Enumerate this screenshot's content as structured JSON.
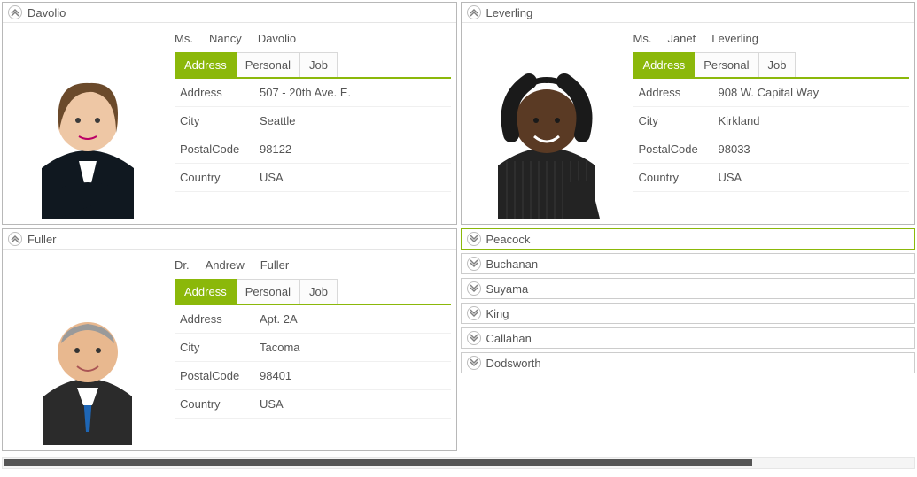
{
  "tabs": {
    "address": "Address",
    "personal": "Personal",
    "job": "Job"
  },
  "field_labels": {
    "address": "Address",
    "city": "City",
    "postal": "PostalCode",
    "country": "Country"
  },
  "left": [
    {
      "header": "Davolio",
      "expanded": true,
      "title": "Ms.",
      "first": "Nancy",
      "last": "Davolio",
      "address": "507 - 20th Ave. E.",
      "city": "Seattle",
      "postal": "98122",
      "country": "USA",
      "photo": "woman-darkblonde-suit"
    },
    {
      "header": "Fuller",
      "expanded": true,
      "title": "Dr.",
      "first": "Andrew",
      "last": "Fuller",
      "address": "Apt. 2A",
      "city": "Tacoma",
      "postal": "98401",
      "country": "USA",
      "photo": "man-gray-suit-tie"
    }
  ],
  "right": [
    {
      "header": "Leverling",
      "expanded": true,
      "title": "Ms.",
      "first": "Janet",
      "last": "Leverling",
      "address": "908 W. Capital Way",
      "city": "Kirkland",
      "postal": "98033",
      "country": "USA",
      "photo": "woman-black-pinstripe"
    },
    {
      "header": "Peacock",
      "expanded": false,
      "selected": true
    },
    {
      "header": "Buchanan",
      "expanded": false
    },
    {
      "header": "Suyama",
      "expanded": false
    },
    {
      "header": "King",
      "expanded": false
    },
    {
      "header": "Callahan",
      "expanded": false
    },
    {
      "header": "Dodsworth",
      "expanded": false
    }
  ]
}
